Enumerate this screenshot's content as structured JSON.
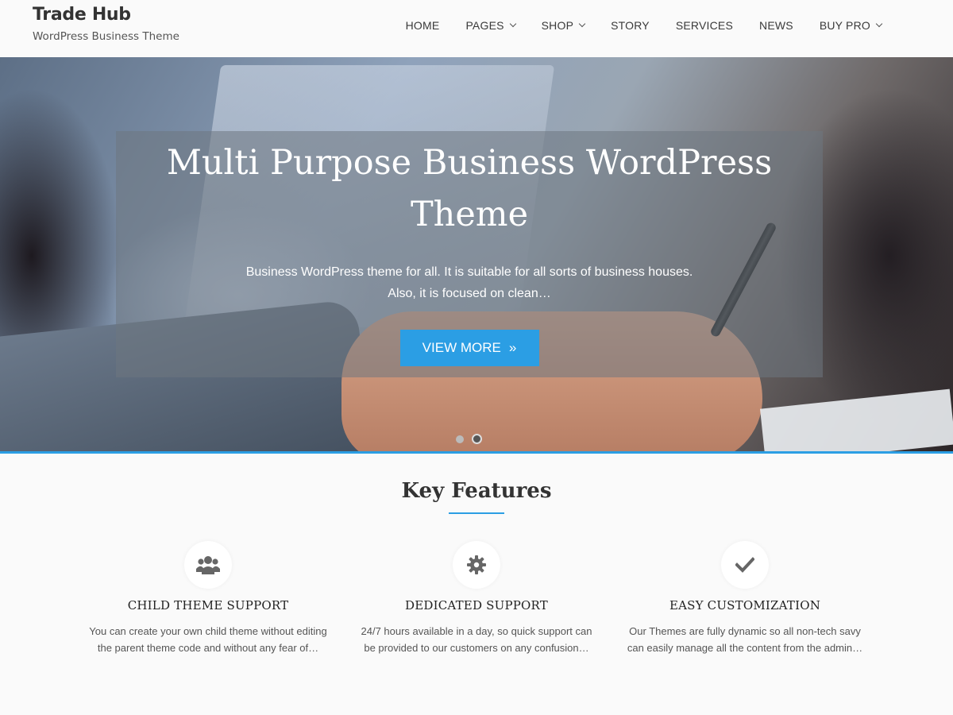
{
  "header": {
    "site_title": "Trade Hub",
    "tagline": "WordPress Business Theme"
  },
  "nav": {
    "items": [
      {
        "label": "HOME",
        "has_dropdown": false
      },
      {
        "label": "PAGES",
        "has_dropdown": true
      },
      {
        "label": "SHOP",
        "has_dropdown": true
      },
      {
        "label": "STORY",
        "has_dropdown": false
      },
      {
        "label": "SERVICES",
        "has_dropdown": false
      },
      {
        "label": "NEWS",
        "has_dropdown": false
      },
      {
        "label": "BUY PRO",
        "has_dropdown": true
      }
    ]
  },
  "hero": {
    "title": "Multi Purpose Business WordPress Theme",
    "description": "Business WordPress theme for all. It is suitable for all sorts of business houses. Also, it is focused on clean…",
    "button_label": "VIEW MORE",
    "button_icon": "double-chevron-right-icon",
    "slide_count": 2,
    "active_slide": 2
  },
  "features": {
    "title": "Key Features",
    "items": [
      {
        "icon": "users-icon",
        "heading": "CHILD THEME SUPPORT",
        "text": "You can create your own child theme without editing the parent theme code and without any fear of…"
      },
      {
        "icon": "gear-icon",
        "heading": "DEDICATED SUPPORT",
        "text": "24/7 hours available in a day, so quick support can be provided to our customers on any confusion…"
      },
      {
        "icon": "check-icon",
        "heading": "EASY CUSTOMIZATION",
        "text": "Our Themes are fully dynamic so all non-tech savy can easily manage all the content from the admin…"
      }
    ]
  },
  "colors": {
    "accent": "#2b9ee4",
    "text_dark": "#333333",
    "background": "#fafafa"
  }
}
